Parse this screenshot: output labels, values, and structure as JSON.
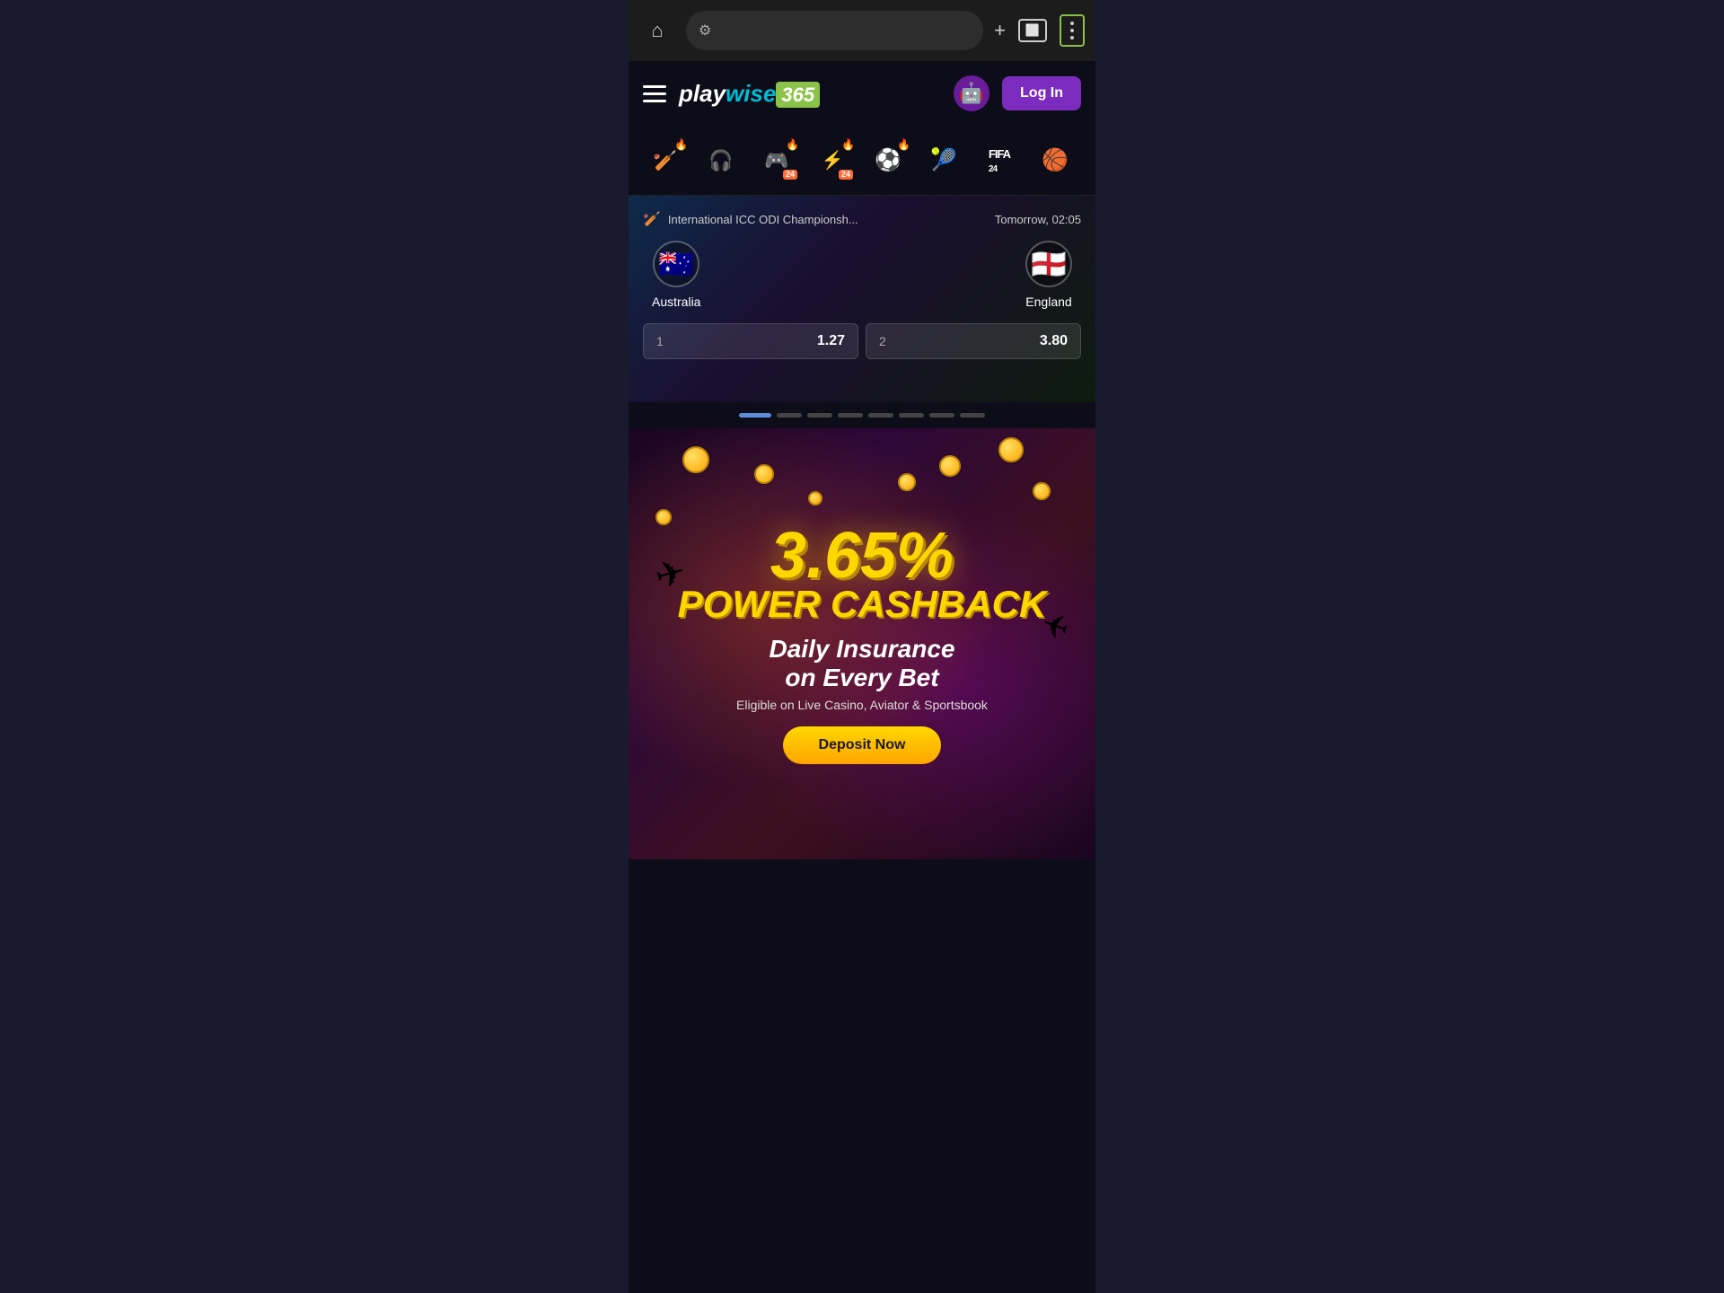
{
  "browser": {
    "url_placeholder": "⚙",
    "home_icon": "⌂",
    "add_tab": "+",
    "tabs_count": ""
  },
  "header": {
    "logo_play": "play",
    "logo_wise": "wise",
    "logo_num": "365",
    "login_label": "Log In"
  },
  "sports_nav": {
    "items": [
      {
        "id": "cricket",
        "icon": "🏏",
        "fire": "🔥",
        "badge": ""
      },
      {
        "id": "headset",
        "icon": "🎧",
        "fire": "",
        "badge": ""
      },
      {
        "id": "esports1",
        "icon": "🎮",
        "fire": "🔥",
        "badge": "24"
      },
      {
        "id": "esports2",
        "icon": "⚡",
        "fire": "🔥",
        "badge": "24"
      },
      {
        "id": "soccer",
        "icon": "⚽",
        "fire": "🔥",
        "badge": ""
      },
      {
        "id": "tennis",
        "icon": "🎾",
        "fire": "",
        "badge": ""
      },
      {
        "id": "fifa",
        "icon": "FIFA",
        "fire": "",
        "badge": "24"
      },
      {
        "id": "basketball",
        "icon": "🏀",
        "fire": "",
        "badge": ""
      }
    ]
  },
  "featured_match": {
    "competition": "International ICC ODI Championsh...",
    "time": "Tomorrow, 02:05",
    "team1": {
      "name": "Australia",
      "flag": "🇦🇺"
    },
    "team2": {
      "name": "England",
      "flag": "🏴󠁧󠁢󠁥󠁮󠁧󠁿"
    },
    "odds": [
      {
        "label": "1",
        "value": "1.27"
      },
      {
        "label": "2",
        "value": "3.80"
      }
    ]
  },
  "carousel": {
    "total_dots": 8,
    "active_dot": 0
  },
  "promo": {
    "cashback_percent": "3.65%",
    "cashback_label": "POWER CASHBACK",
    "subtitle": "Daily Insurance",
    "subtitle2": "on Every Bet",
    "description": "Eligible on Live Casino, Aviator & Sportsbook",
    "cta_label": "Deposit Now"
  }
}
